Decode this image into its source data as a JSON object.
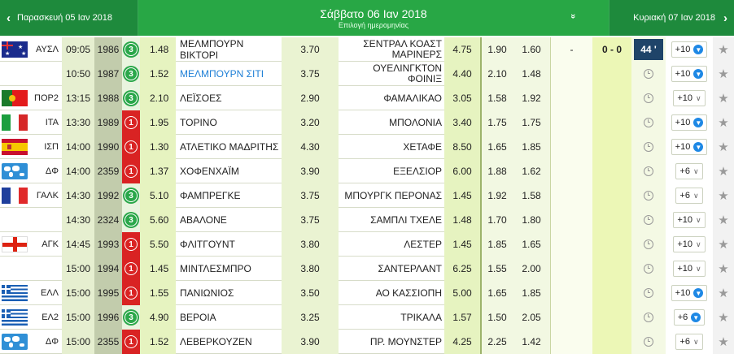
{
  "nav": {
    "prev_label": "Παρασκευή 05 Ιαν 2018",
    "prev_arrow": "‹",
    "current_date": "Σάββατο 06 Ιαν 2018",
    "current_sub": "Επιλογή ημερομηνίας",
    "dropdown_icon": "»",
    "next_label": "Κυριακή 07 Ιαν 2018",
    "next_arrow": "›"
  },
  "matches": [
    {
      "flag": "australia",
      "country": "ΑΥΣΛ",
      "time": "09:05",
      "code": "1986",
      "badge": "3",
      "badge_color": "green",
      "odd1": "1.48",
      "home": "ΜΕΛΜΠΟΥΡΝ ΒΙΚΤΟΡΙ",
      "oddx": "3.70",
      "away": "ΣΕΝΤΡΑΛ ΚΟΑΣΤ ΜΑΡΙΝΕΡΣ",
      "odd2": "4.75",
      "under": "1.90",
      "over": "1.60",
      "live_dash": "-",
      "live_score": "0 - 0",
      "minute": "44 '",
      "more": "+10",
      "more_style": "blue",
      "home_link": false
    },
    {
      "flag": "",
      "country": "",
      "time": "10:50",
      "code": "1987",
      "badge": "3",
      "badge_color": "green",
      "odd1": "1.52",
      "home": "ΜΕΛΜΠΟΥΡΝ ΣΙΤΙ",
      "oddx": "3.75",
      "away": "ΟΥΕΛΙΝΓΚΤΟΝ ΦΟΙΝΙΞ",
      "odd2": "4.40",
      "under": "2.10",
      "over": "1.48",
      "live_dash": "",
      "live_score": "",
      "minute": "",
      "more": "+10",
      "more_style": "blue",
      "home_link": true
    },
    {
      "flag": "portugal",
      "country": "ΠΟΡ2",
      "time": "13:15",
      "code": "1988",
      "badge": "3",
      "badge_color": "green",
      "odd1": "2.10",
      "home": "ΛΕΪΣΟΕΣ",
      "oddx": "2.90",
      "away": "ΦΑΜΑΛΙΚΑΟ",
      "odd2": "3.05",
      "under": "1.58",
      "over": "1.92",
      "live_dash": "",
      "live_score": "",
      "minute": "",
      "more": "+10",
      "more_style": "chevron",
      "home_link": false
    },
    {
      "flag": "italy",
      "country": "ΙΤΑ",
      "time": "13:30",
      "code": "1989",
      "badge": "1",
      "badge_color": "red",
      "odd1": "1.95",
      "home": "ΤΟΡΙΝΟ",
      "oddx": "3.20",
      "away": "ΜΠΟΛΟΝΙΑ",
      "odd2": "3.40",
      "under": "1.75",
      "over": "1.75",
      "live_dash": "",
      "live_score": "",
      "minute": "",
      "more": "+10",
      "more_style": "blue",
      "home_link": false
    },
    {
      "flag": "spain",
      "country": "ΙΣΠ",
      "time": "14:00",
      "code": "1990",
      "badge": "1",
      "badge_color": "red",
      "odd1": "1.30",
      "home": "ΑΤΛΕΤΙΚΟ ΜΑΔΡΙΤΗΣ",
      "oddx": "4.30",
      "away": "ΧΕΤΑΦΕ",
      "odd2": "8.50",
      "under": "1.65",
      "over": "1.85",
      "live_dash": "",
      "live_score": "",
      "minute": "",
      "more": "+10",
      "more_style": "blue",
      "home_link": false
    },
    {
      "flag": "world",
      "country": "ΔΦ",
      "time": "14:00",
      "code": "2359",
      "badge": "1",
      "badge_color": "red",
      "odd1": "1.37",
      "home": "ΧΟΦΕΝΧΑΪΜ",
      "oddx": "3.90",
      "away": "ΕΞΕΛΣΙΟΡ",
      "odd2": "6.00",
      "under": "1.88",
      "over": "1.62",
      "live_dash": "",
      "live_score": "",
      "minute": "",
      "more": "+6",
      "more_style": "chevron",
      "home_link": false
    },
    {
      "flag": "france",
      "country": "ΓΑΛΚ",
      "time": "14:30",
      "code": "1992",
      "badge": "3",
      "badge_color": "green",
      "odd1": "5.10",
      "home": "ΦΑΜΠΡΕΓΚΕ",
      "oddx": "3.75",
      "away": "ΜΠΟΥΡΓΚ ΠΕΡΟΝΑΣ",
      "odd2": "1.45",
      "under": "1.92",
      "over": "1.58",
      "live_dash": "",
      "live_score": "",
      "minute": "",
      "more": "+6",
      "more_style": "chevron",
      "home_link": false
    },
    {
      "flag": "",
      "country": "",
      "time": "14:30",
      "code": "2324",
      "badge": "3",
      "badge_color": "green",
      "odd1": "5.60",
      "home": "ΑΒΑΛΟΝΕ",
      "oddx": "3.75",
      "away": "ΣΑΜΠΛΙ ΤΧΕΛΕ",
      "odd2": "1.48",
      "under": "1.70",
      "over": "1.80",
      "live_dash": "",
      "live_score": "",
      "minute": "",
      "more": "+10",
      "more_style": "chevron",
      "home_link": false
    },
    {
      "flag": "england",
      "country": "ΑΓΚ",
      "time": "14:45",
      "code": "1993",
      "badge": "1",
      "badge_color": "red",
      "odd1": "5.50",
      "home": "ΦΛΙΤΓΟΥΝΤ",
      "oddx": "3.80",
      "away": "ΛΕΣΤΕΡ",
      "odd2": "1.45",
      "under": "1.85",
      "over": "1.65",
      "live_dash": "",
      "live_score": "",
      "minute": "",
      "more": "+10",
      "more_style": "chevron",
      "home_link": false
    },
    {
      "flag": "",
      "country": "",
      "time": "15:00",
      "code": "1994",
      "badge": "1",
      "badge_color": "red",
      "odd1": "1.45",
      "home": "ΜΙΝΤΛΕΣΜΠΡΟ",
      "oddx": "3.80",
      "away": "ΣΑΝΤΕΡΛΑΝΤ",
      "odd2": "6.25",
      "under": "1.55",
      "over": "2.00",
      "live_dash": "",
      "live_score": "",
      "minute": "",
      "more": "+10",
      "more_style": "chevron",
      "home_link": false
    },
    {
      "flag": "greece",
      "country": "ΕΛΛ",
      "time": "15:00",
      "code": "1995",
      "badge": "1",
      "badge_color": "red",
      "odd1": "1.55",
      "home": "ΠΑΝΙΩΝΙΟΣ",
      "oddx": "3.50",
      "away": "ΑΟ ΚΑΣΣΙΟΠΗ",
      "odd2": "5.00",
      "under": "1.65",
      "over": "1.85",
      "live_dash": "",
      "live_score": "",
      "minute": "",
      "more": "+10",
      "more_style": "blue",
      "home_link": false
    },
    {
      "flag": "greece",
      "country": "ΕΛ2",
      "time": "15:00",
      "code": "1996",
      "badge": "3",
      "badge_color": "green",
      "odd1": "4.90",
      "home": "ΒΕΡΟΙΑ",
      "oddx": "3.25",
      "away": "ΤΡΙΚΑΛΑ",
      "odd2": "1.57",
      "under": "1.50",
      "over": "2.05",
      "live_dash": "",
      "live_score": "",
      "minute": "",
      "more": "+6",
      "more_style": "blue",
      "home_link": false
    },
    {
      "flag": "world",
      "country": "ΔΦ",
      "time": "15:00",
      "code": "2355",
      "badge": "1",
      "badge_color": "red",
      "odd1": "1.52",
      "home": "ΛΕΒΕΡΚΟΥΖΕΝ",
      "oddx": "3.90",
      "away": "ΠΡ. ΜΟΥΝΣΤΕΡ",
      "odd2": "4.25",
      "under": "2.25",
      "over": "1.42",
      "live_dash": "",
      "live_score": "",
      "minute": "",
      "more": "+6",
      "more_style": "chevron",
      "home_link": false
    }
  ],
  "icons": {
    "favorite": "star-icon",
    "pending": "clock-icon",
    "expand": "arrow-down-icon"
  }
}
